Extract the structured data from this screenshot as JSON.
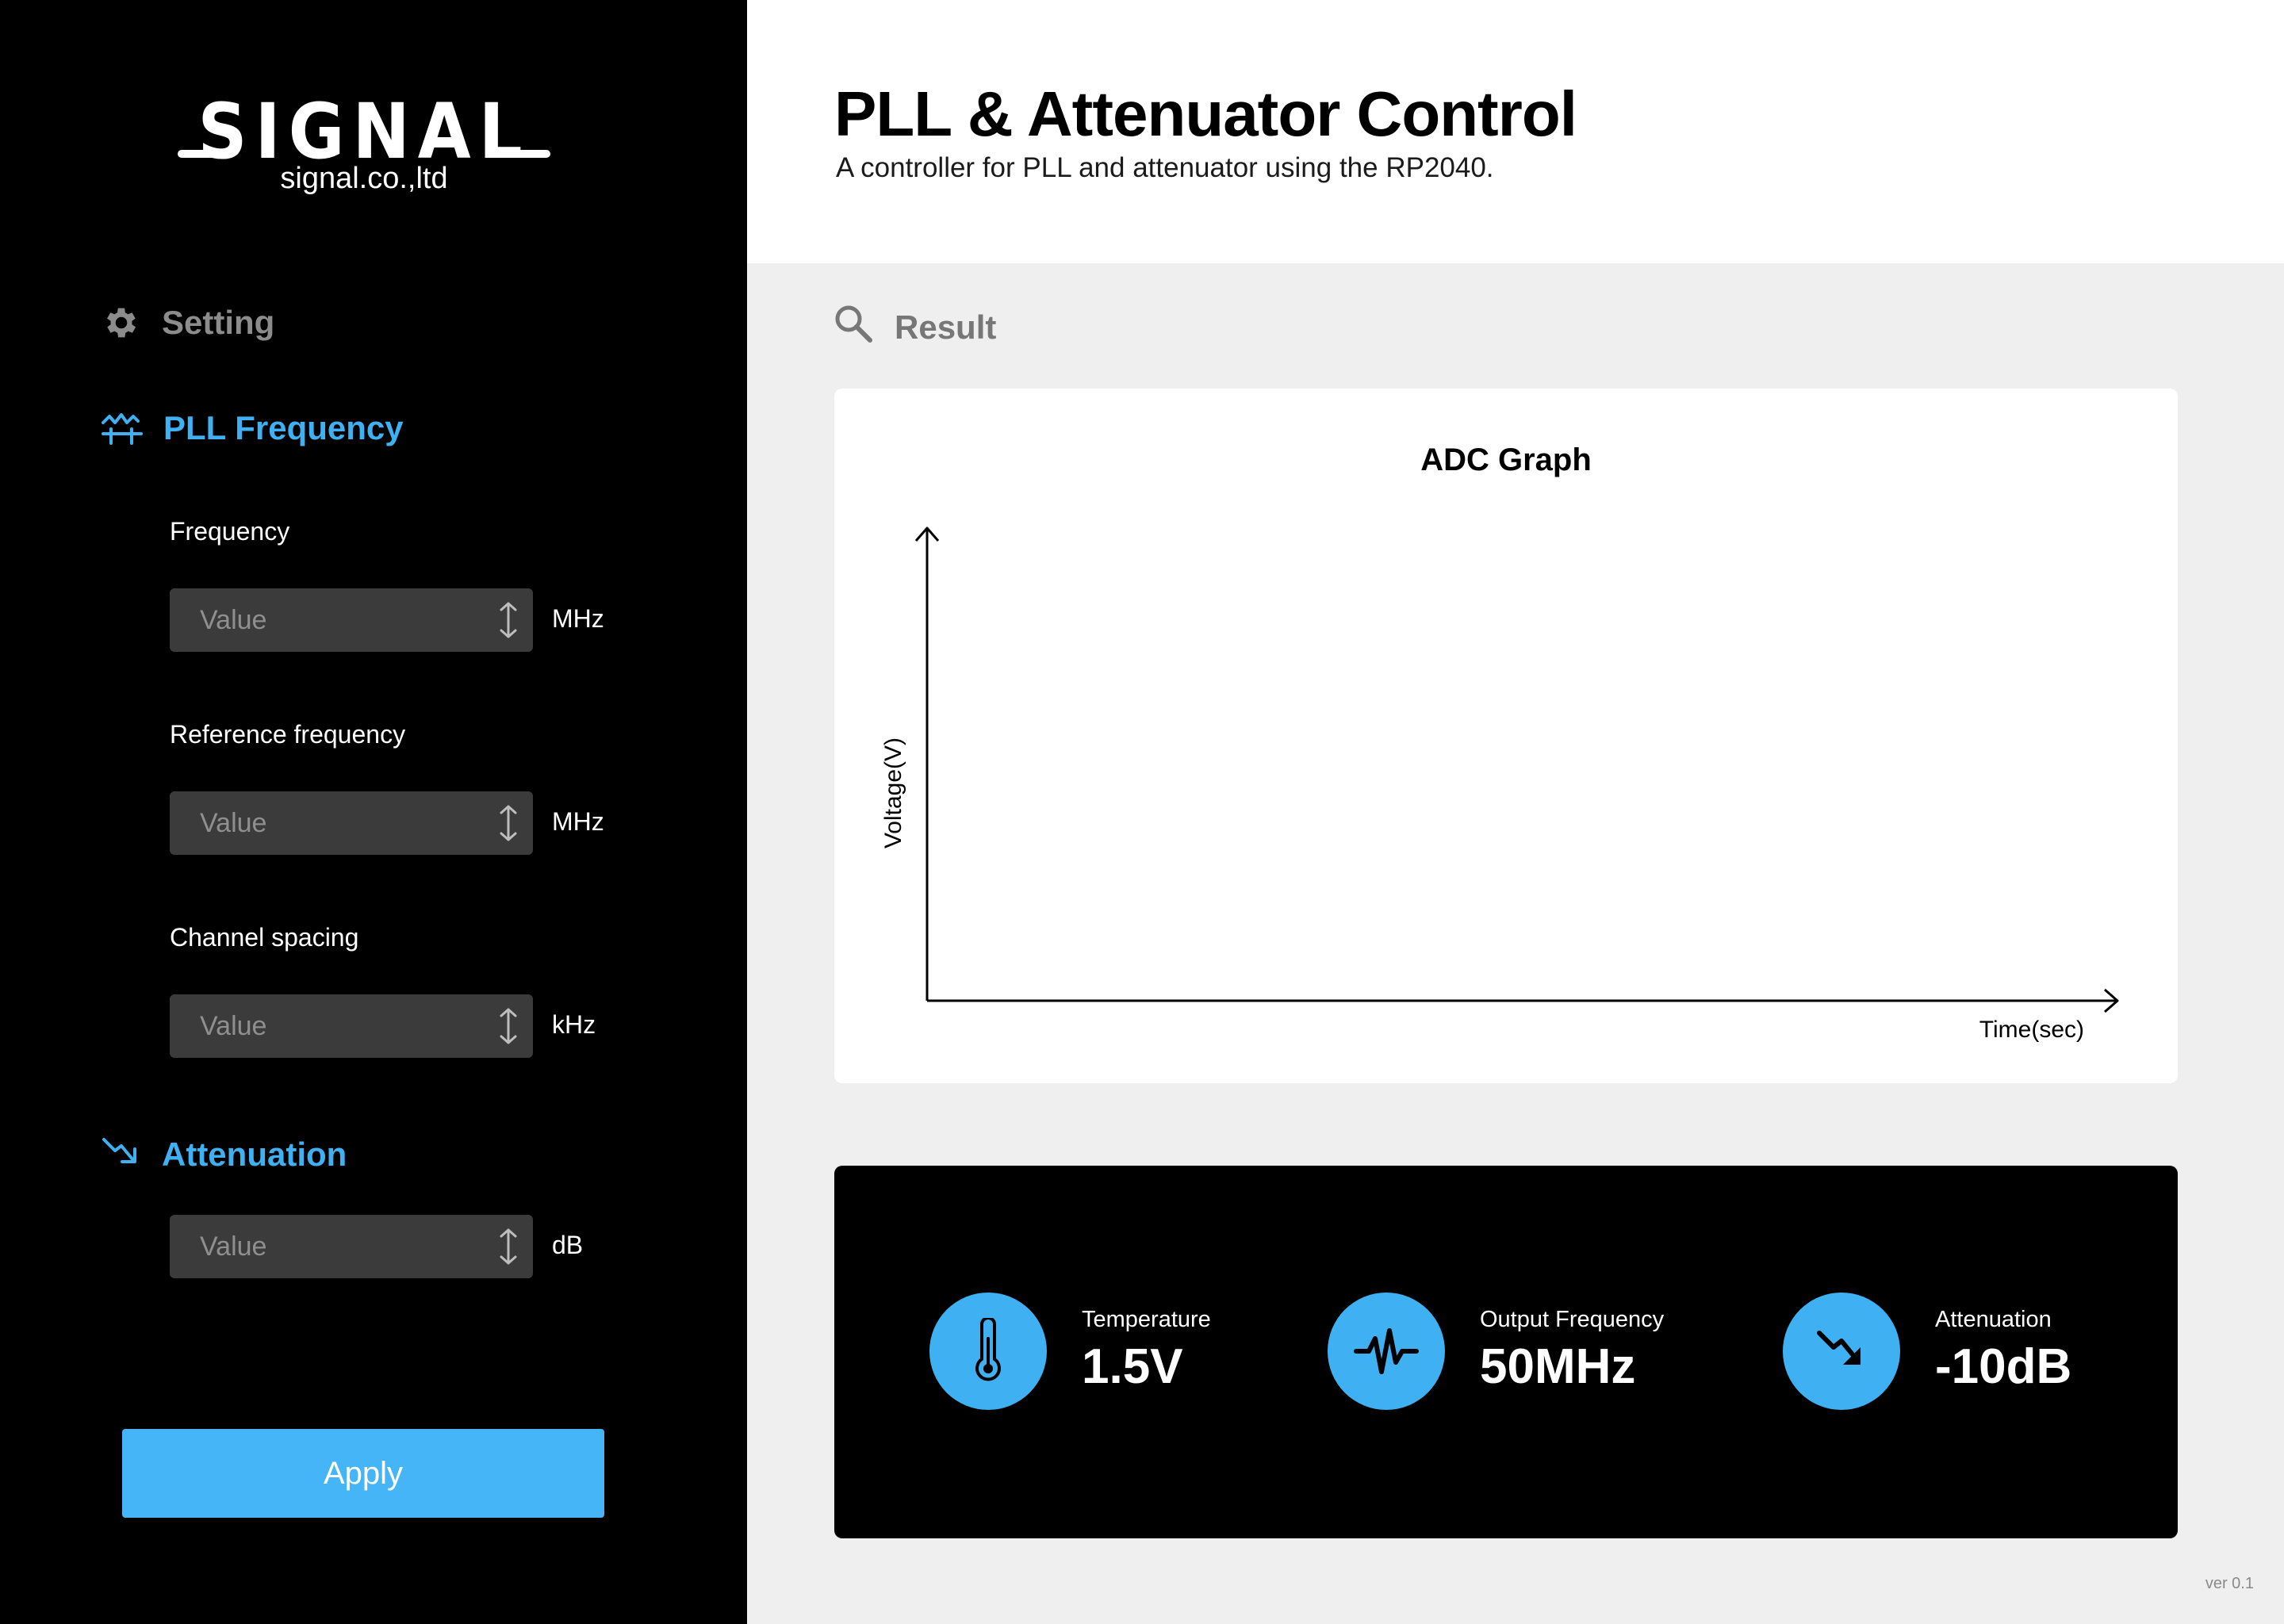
{
  "brand": {
    "logo_text": "SIGNAL",
    "company": "signal.co.,ltd"
  },
  "sidebar": {
    "setting": {
      "label": "Setting",
      "icon": "gear-icon"
    },
    "pll": {
      "label": "PLL Frequency",
      "icon": "pll-wave-icon",
      "fields": [
        {
          "label": "Frequency",
          "placeholder": "Value",
          "unit": "MHz"
        },
        {
          "label": "Reference frequency",
          "placeholder": "Value",
          "unit": "MHz"
        },
        {
          "label": "Channel spacing",
          "placeholder": "Value",
          "unit": "kHz"
        }
      ]
    },
    "attenuation": {
      "label": "Attenuation",
      "icon": "trend-down-icon",
      "field": {
        "placeholder": "Value",
        "unit": "dB"
      }
    },
    "apply_label": "Apply"
  },
  "header": {
    "title": "PLL & Attenuator Control",
    "subtitle": "A controller for PLL and attenuator using the RP2040."
  },
  "result": {
    "label": "Result",
    "icon": "search-icon",
    "graph": {
      "title": "ADC Graph",
      "ylabel": "Voltage(V)",
      "xlabel": "Time(sec)"
    }
  },
  "stats": [
    {
      "label": "Temperature",
      "value": "1.5V",
      "icon": "thermometer-icon"
    },
    {
      "label": "Output Frequency",
      "value": "50MHz",
      "icon": "waveform-icon"
    },
    {
      "label": "Attenuation",
      "value": "-10dB",
      "icon": "trend-down-icon"
    }
  ],
  "version": "ver 0.1",
  "colors": {
    "accent": "#3fb1f2",
    "button": "#45b5f7",
    "sidebar": "#000000",
    "input": "#3b3b3b"
  }
}
